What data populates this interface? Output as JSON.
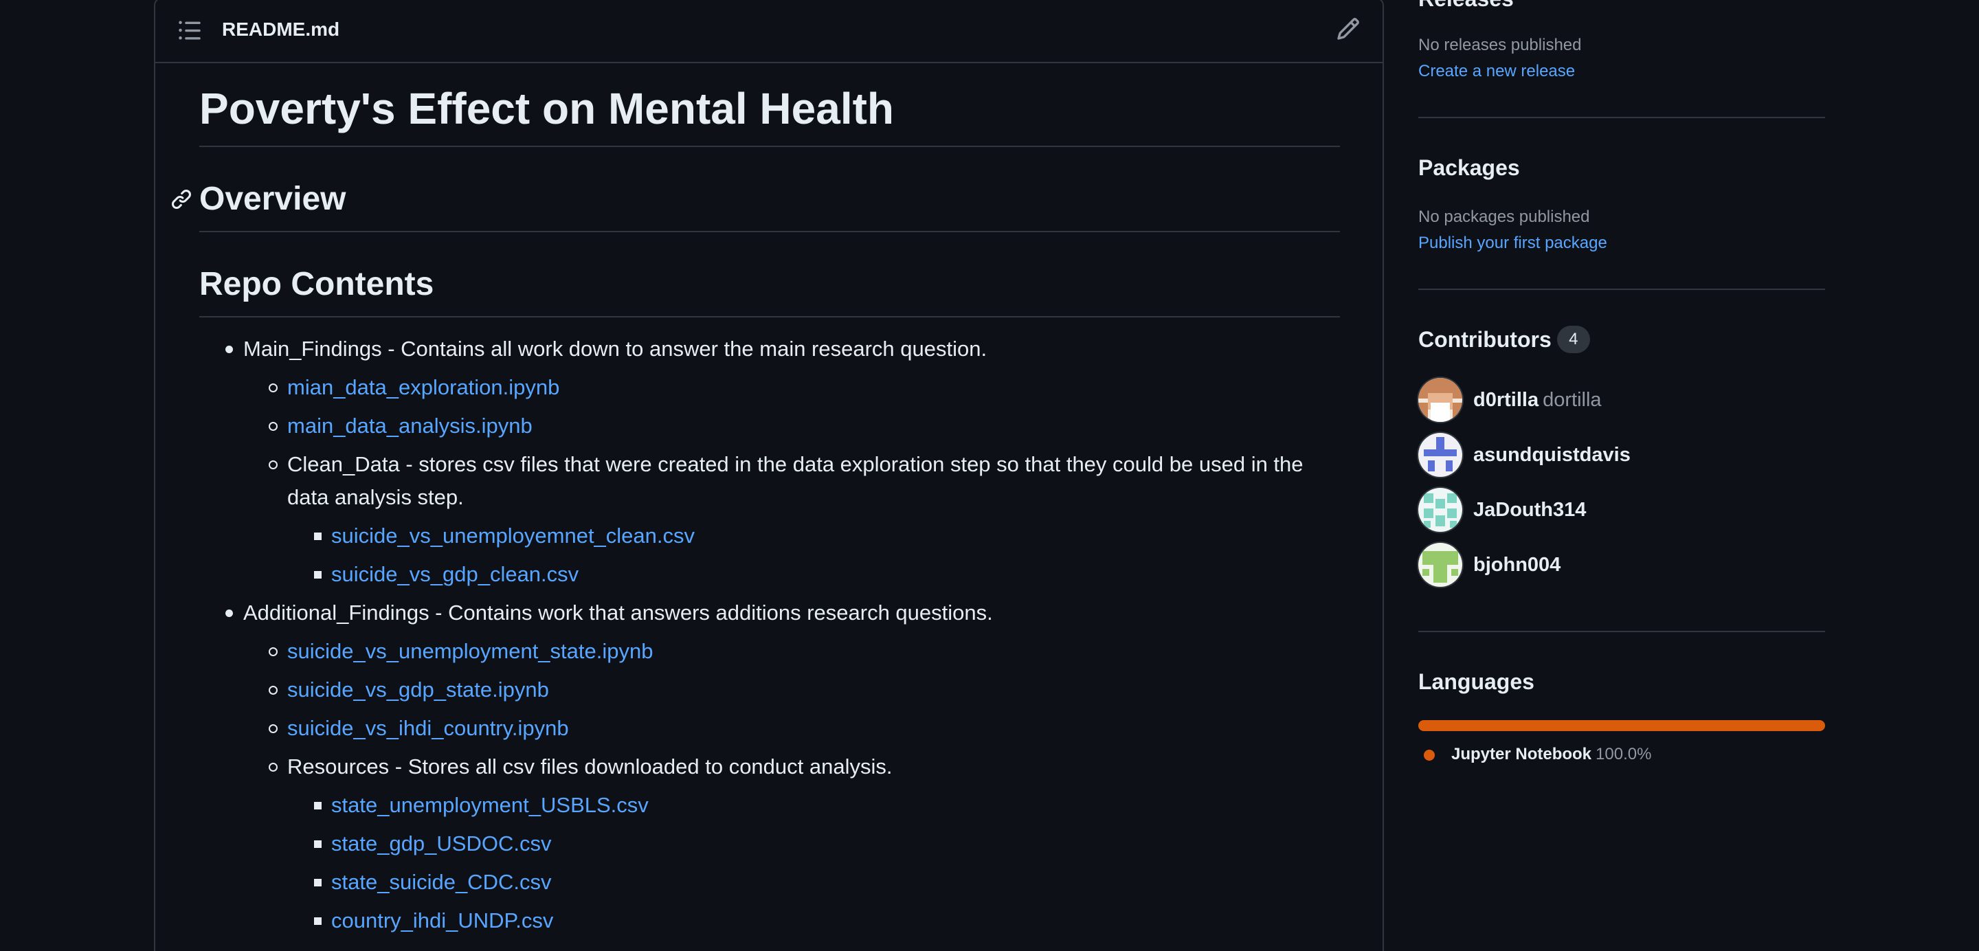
{
  "readme": {
    "filename": "README.md",
    "title": "Poverty's Effect on Mental Health",
    "overview_heading": "Overview",
    "contents_heading": "Repo Contents",
    "items": [
      {
        "text": "Main_Findings - Contains all work down to answer the main research question.",
        "children": [
          {
            "link": "mian_data_exploration.ipynb"
          },
          {
            "link": "main_data_analysis.ipynb"
          },
          {
            "text": "Clean_Data - stores csv files that were created in the data exploration step so that they could be used in the data analysis step.",
            "children": [
              {
                "link": "suicide_vs_unemployemnet_clean.csv"
              },
              {
                "link": "suicide_vs_gdp_clean.csv"
              }
            ]
          }
        ]
      },
      {
        "text": "Additional_Findings - Contains work that answers additions research questions.",
        "children": [
          {
            "link": "suicide_vs_unemployment_state.ipynb"
          },
          {
            "link": "suicide_vs_gdp_state.ipynb"
          },
          {
            "link": "suicide_vs_ihdi_country.ipynb"
          },
          {
            "text": "Resources - Stores all csv files downloaded to conduct analysis.",
            "children": [
              {
                "link": "state_unemployment_USBLS.csv"
              },
              {
                "link": "state_gdp_USDOC.csv"
              },
              {
                "link": "state_suicide_CDC.csv"
              },
              {
                "link": "country_ihdi_UNDP.csv"
              }
            ]
          }
        ]
      }
    ]
  },
  "sidebar": {
    "releases": {
      "heading": "Releases",
      "empty_text": "No releases published",
      "link": "Create a new release"
    },
    "packages": {
      "heading": "Packages",
      "empty_text": "No packages published",
      "link": "Publish your first package"
    },
    "contributors": {
      "heading": "Contributors",
      "count": "4",
      "list": [
        {
          "login": "d0rtilla",
          "name": "dortilla"
        },
        {
          "login": "asundquistdavis",
          "name": ""
        },
        {
          "login": "JaDouth314",
          "name": ""
        },
        {
          "login": "bjohn004",
          "name": ""
        }
      ]
    },
    "languages": {
      "heading": "Languages",
      "items": [
        {
          "name": "Jupyter Notebook",
          "percent": "100.0%",
          "color": "#da5b0b",
          "share": 1.0
        }
      ]
    }
  },
  "colors": {
    "background": "#0d1117",
    "text": "#e6edf3",
    "muted": "#9198a1",
    "link": "#58a6ff",
    "border": "#30363d"
  },
  "icons": {
    "toc": "list-unordered-icon",
    "edit": "pencil-icon",
    "anchor": "link-icon"
  }
}
